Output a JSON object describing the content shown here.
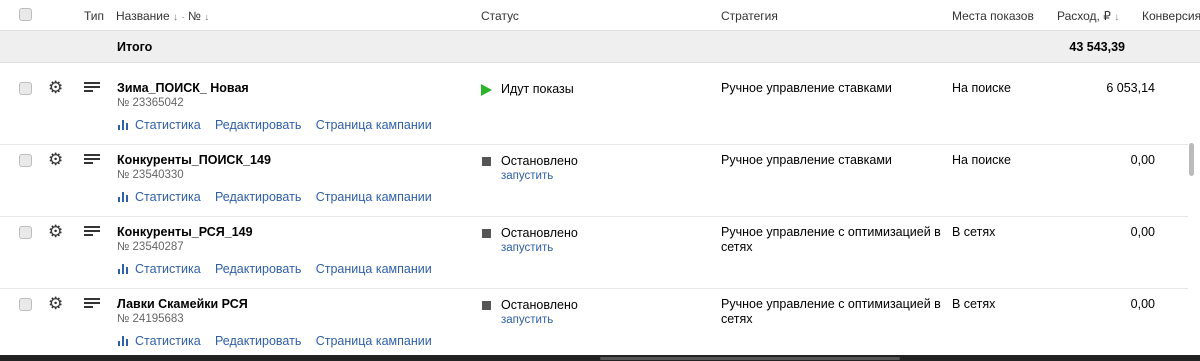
{
  "header": {
    "type": "Тип",
    "name": "Название",
    "sort_down": "↓",
    "dot": "·",
    "number": "№",
    "number_sort": "↓",
    "status": "Статус",
    "strategy": "Стратегия",
    "placement": "Места показов",
    "spend": "Расход, ₽",
    "spend_sort": "↓",
    "conversions": "Конверсия"
  },
  "totals": {
    "label": "Итого",
    "spend": "43 543,39"
  },
  "links": {
    "stats": "Статистика",
    "edit": "Редактировать",
    "page": "Страница кампании"
  },
  "rows": [
    {
      "name": "Зима_ПОИСК_ Новая",
      "number": "№ 23365042",
      "status": "Идут показы",
      "status_action": "",
      "strategy": "Ручное управление ставками",
      "placement": "На поиске",
      "spend": "6 053,14"
    },
    {
      "name": "Конкуренты_ПОИСК_149",
      "number": "№ 23540330",
      "status": "Остановлено",
      "status_action": "запустить",
      "strategy": "Ручное управление ставками",
      "placement": "На поиске",
      "spend": "0,00"
    },
    {
      "name": "Конкуренты_РСЯ_149",
      "number": "№ 23540287",
      "status": "Остановлено",
      "status_action": "запустить",
      "strategy": "Ручное управление с оптимизацией в сетях",
      "placement": "В сетях",
      "spend": "0,00"
    },
    {
      "name": "Лавки Скамейки РСЯ",
      "number": "№ 24195683",
      "status": "Остановлено",
      "status_action": "запустить",
      "strategy": "Ручное управление с оптимизацией в сетях",
      "placement": "В сетях",
      "spend": "0,00"
    }
  ]
}
